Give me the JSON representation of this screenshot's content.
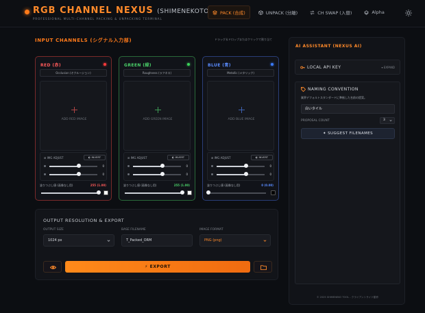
{
  "header": {
    "title": "RGB CHANNEL NEXUS",
    "title_sub": "(SHIMENEKOTOOL)",
    "tagline": "PROFESSIONAL MULTI-CHANNEL PACKING & UNPACKING TERMINAL",
    "tabs": [
      {
        "label": "PACK (合成)",
        "icon": "stack-icon",
        "active": true
      },
      {
        "label": "UNPACK (分離)",
        "icon": "box-icon",
        "active": false
      },
      {
        "label": "CH SWAP (入替)",
        "icon": "swap-icon",
        "active": false
      },
      {
        "label": "Alpha",
        "icon": "layers-icon",
        "active": false
      }
    ]
  },
  "input": {
    "title": "INPUT CHANNELS (シグナル入力部)",
    "hint": "ドラッグ＆ドロップまたはクリックで割り当て"
  },
  "channels": [
    {
      "title": "RED (赤)",
      "preset": "Occlusion (オクルージョン)",
      "drop_label": "ADD RED IMAGE",
      "adjust_label": "IMG ADJUST",
      "invert_label": "INVERT",
      "slider1_value": 0.62,
      "slider1_text": "0",
      "slider2_value": 0.62,
      "slider2_text": "0",
      "fill_label": "塗りつぶし値 (画像なし用)",
      "fill_value": "255 (1.00)",
      "fill_level": 1.0,
      "fill_color": "#ffffff"
    },
    {
      "title": "GREEN (緑)",
      "preset": "Roughness (ラフネス)",
      "drop_label": "ADD GREEN IMAGE",
      "adjust_label": "IMG ADJUST",
      "invert_label": "INVERT",
      "slider1_value": 0.62,
      "slider1_text": "0",
      "slider2_value": 0.62,
      "slider2_text": "0",
      "fill_label": "塗りつぶし値 (画像なし用)",
      "fill_value": "255 (1.00)",
      "fill_level": 1.0,
      "fill_color": "#ffffff"
    },
    {
      "title": "BLUE (青)",
      "preset": "Metallic (メタリック)",
      "drop_label": "ADD BLUE IMAGE",
      "adjust_label": "IMG ADJUST",
      "invert_label": "INVERT",
      "slider1_value": 0.62,
      "slider1_text": "0",
      "slider2_value": 0.62,
      "slider2_text": "0",
      "fill_label": "塗りつぶし値 (画像なし用)",
      "fill_value": "0 (0.00)",
      "fill_level": 0.0,
      "fill_color": "#000000"
    }
  ],
  "output": {
    "title": "OUTPUT RESOLUTION & EXPORT",
    "size_label": "OUTPUT SIZE",
    "size_value": "1024 px",
    "filename_label": "BASE FILENAME",
    "filename_value": "T_Packed_ORM",
    "format_label": "IMAGE FORMAT",
    "format_value": "PNG (png)",
    "export_label": "EXPORT"
  },
  "ai": {
    "title": "AI ASSISTANT (NEXUS AI)",
    "api_label": "LOCAL API KEY",
    "expand_label": "EXPAND",
    "naming_title": "NAMING CONVENTION",
    "naming_desc": "業界デフォルトスタンダードに準拠した名前の提案。",
    "naming_input": "白いタイル",
    "proposal_label": "PROPOSAL COUNT",
    "proposal_value": "3",
    "suggest_label": "SUGGEST FILENAMES",
    "footer": "© 2025 SHIMENEKO TOOL - クライアントサイド動作"
  }
}
